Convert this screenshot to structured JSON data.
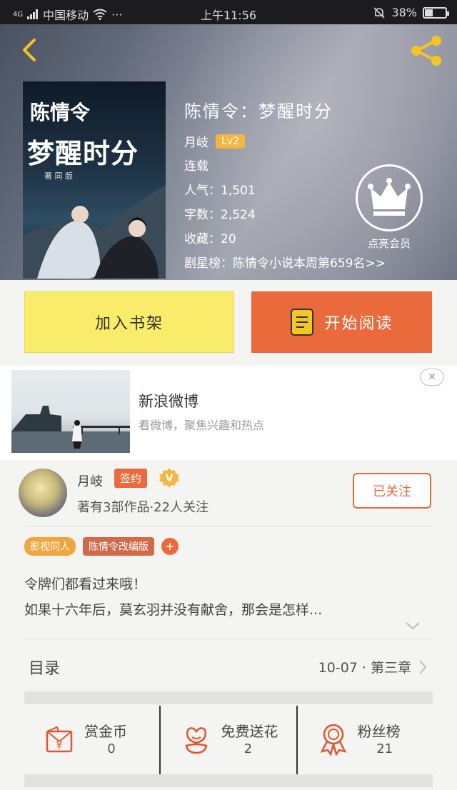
{
  "status_bar": {
    "carrier": "中国移动",
    "signal_label": "4G",
    "time": "上午11:56",
    "battery": "38%",
    "battery_level": 0.38,
    "more": "···"
  },
  "book": {
    "cover_title_line1": "陈情令",
    "cover_title_line2": "梦醒时分",
    "cover_caption": "著 同 版",
    "title": "陈情令：梦醒时分",
    "author": "月岐",
    "level": "Lv2",
    "status": "连载",
    "popularity": "人气：1,501",
    "word_count": "字数：2,524",
    "favorites": "收藏：20",
    "ranking": "剧星榜：陈情令小说本周第659名>>"
  },
  "vip": {
    "label": "点亮会员",
    "icon": "crown-icon"
  },
  "actions": {
    "add_to_shelf": "加入书架",
    "start_reading": "开始阅读"
  },
  "ad": {
    "title": "新浪微博",
    "subtitle": "看微博，聚焦兴趣和热点",
    "close": "✕"
  },
  "author_card": {
    "name": "月岐",
    "signed_badge": "签约",
    "verified_badge": "V",
    "stats": "著有3部作品·22人关注",
    "follow_button": "已关注"
  },
  "tags": [
    "影视同人",
    "陈情令改编版"
  ],
  "tag_add": "+",
  "description": [
    "令牌们都看过来哦！",
    "如果十六年后，莫玄羽并没有献舍，那会是怎样..."
  ],
  "toc": {
    "label": "目录",
    "latest": "10-07 · 第三章"
  },
  "bottom_stats": [
    {
      "name": "赏金币",
      "value": "0",
      "icon": "coin-envelope-icon"
    },
    {
      "name": "免费送花",
      "value": "2",
      "icon": "flower-icon"
    },
    {
      "name": "粉丝榜",
      "value": "21",
      "icon": "medal-icon"
    }
  ],
  "colors": {
    "accent": "#ea6a3c",
    "shelf_button": "#f9ec6a",
    "icon_yellow": "#f3c623",
    "level_badge": "#f3b640"
  }
}
